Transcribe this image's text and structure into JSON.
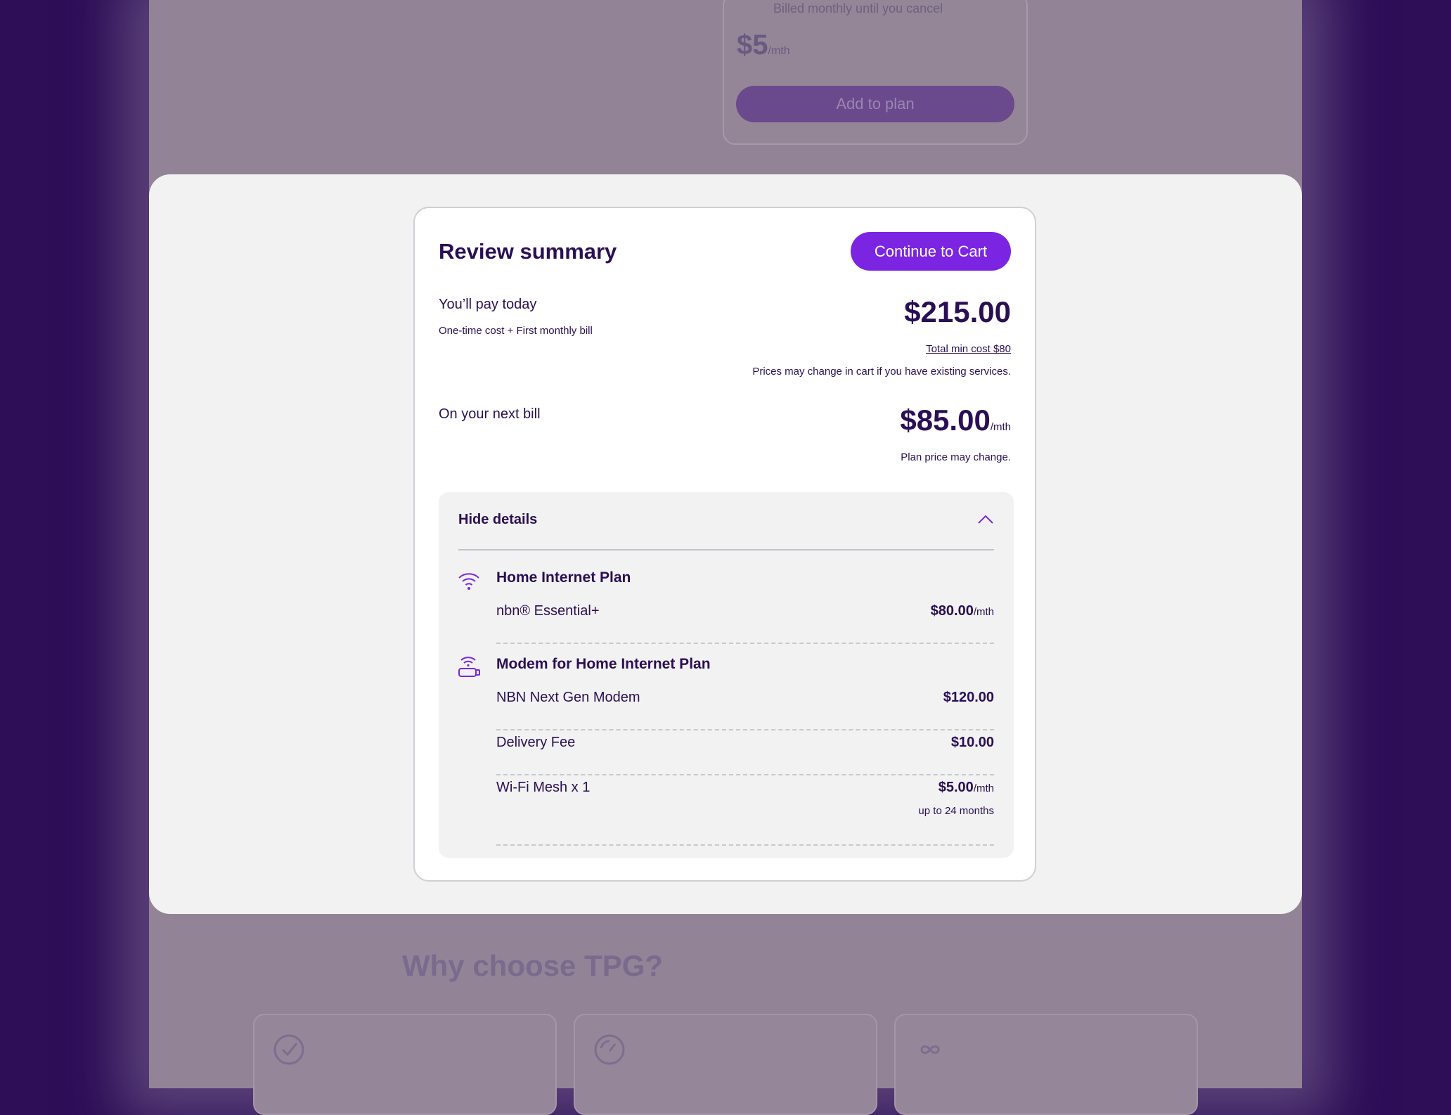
{
  "background": {
    "addon_card": {
      "billed_text": "Billed monthly until you cancel",
      "price": "$5",
      "price_unit": "/mth",
      "button_label": "Add to plan"
    },
    "why_title": "Why choose TPG?"
  },
  "modal": {
    "title": "Review summary",
    "cta_label": "Continue to Cart",
    "pay_today": {
      "label": "You’ll pay today",
      "sublabel": "One-time cost + First monthly bill",
      "amount": "$215.00",
      "min_cost_link": "Total min cost $80",
      "note": "Prices may change in cart if you have existing services."
    },
    "next_bill": {
      "label": "On your next bill",
      "amount": "$85.00",
      "unit": "/mth",
      "note": "Plan price may change."
    },
    "details": {
      "toggle_label": "Hide details",
      "sections": [
        {
          "title": "Home Internet Plan",
          "icon": "wifi-icon",
          "items": [
            {
              "name": "nbn® Essential+",
              "price": "$80.00",
              "unit": "/mth"
            }
          ]
        },
        {
          "title": "Modem for Home Internet Plan",
          "icon": "modem-icon",
          "items": [
            {
              "name": "NBN Next Gen Modem",
              "price": "$120.00",
              "unit": ""
            },
            {
              "name": "Delivery Fee",
              "price": "$10.00",
              "unit": ""
            },
            {
              "name": "Wi-Fi Mesh x 1",
              "price": "$5.00",
              "unit": "/mth",
              "note": "up to 24 months"
            }
          ]
        }
      ]
    }
  },
  "colors": {
    "accent": "#7b25e3",
    "text": "#2a0f55",
    "overlay": "#928496",
    "side": "#2d0e57"
  }
}
